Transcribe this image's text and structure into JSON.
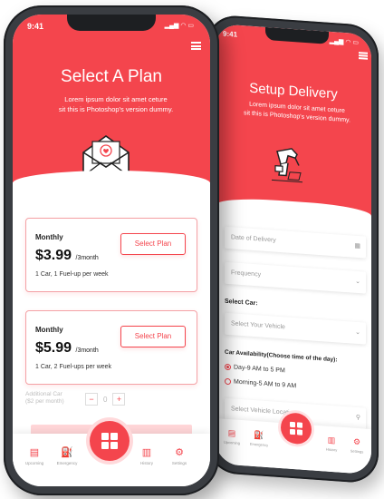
{
  "colors": {
    "accent": "#f4454d",
    "accent_light": "#ffd6d8",
    "frame": "#3a3d42"
  },
  "plan_screen": {
    "time": "9:41",
    "title": "Select A Plan",
    "subtitle_line1": "Lorem ipsum dolor sit amet ceture",
    "subtitle_line2": "sit  this is Photoshop's version dummy.",
    "hero_icon": "envelope-heart-icon",
    "plans": [
      {
        "name": "Monthly",
        "price": "$3.99",
        "period": "/3month",
        "desc": "1 Car, 1 Fuel-up per week",
        "button": "Select Plan"
      },
      {
        "name": "Monthly",
        "price": "$5.99",
        "period": "/3month",
        "desc": "1 Car, 2 Fuel-ups per week",
        "button": "Select Plan"
      }
    ],
    "additional_line1": "Additional Car",
    "additional_line2": "($2 per month)",
    "stepper": {
      "minus": "−",
      "value": "0",
      "plus": "+"
    },
    "nav": {
      "items": [
        {
          "icon": "document-icon",
          "label": "Upcoming"
        },
        {
          "icon": "fuel-icon",
          "label": "Emergency"
        },
        {
          "icon": "receipt-icon",
          "label": "History"
        },
        {
          "icon": "gear-icon",
          "label": "Settings"
        }
      ]
    }
  },
  "delivery_screen": {
    "time": "9:41",
    "title": "Setup Delivery",
    "subtitle_line1": "Lorem ipsum dolor sit amet ceture",
    "subtitle_line2": "sit  this is Photoshop's version dummy.",
    "hero_icon": "fuel-nozzle-icon",
    "date_placeholder": "Date of Delivery",
    "frequency_placeholder": "Frequency",
    "select_car_label": "Select Car:",
    "vehicle_placeholder": "Select Your Vehicle",
    "availability_label": "Car Availability(Choose time of the day):",
    "options": [
      {
        "label": "Day-9 AM to 5 PM",
        "selected": true
      },
      {
        "label": "Morning-5 AM to 9 AM",
        "selected": false
      }
    ],
    "location_placeholder": "Select Vehicle Location",
    "nav": {
      "items": [
        {
          "icon": "document-icon",
          "label": "Upcoming"
        },
        {
          "icon": "fuel-icon",
          "label": "Emergency"
        },
        {
          "icon": "receipt-icon",
          "label": "History"
        },
        {
          "icon": "gear-icon",
          "label": "Settings"
        }
      ]
    }
  }
}
